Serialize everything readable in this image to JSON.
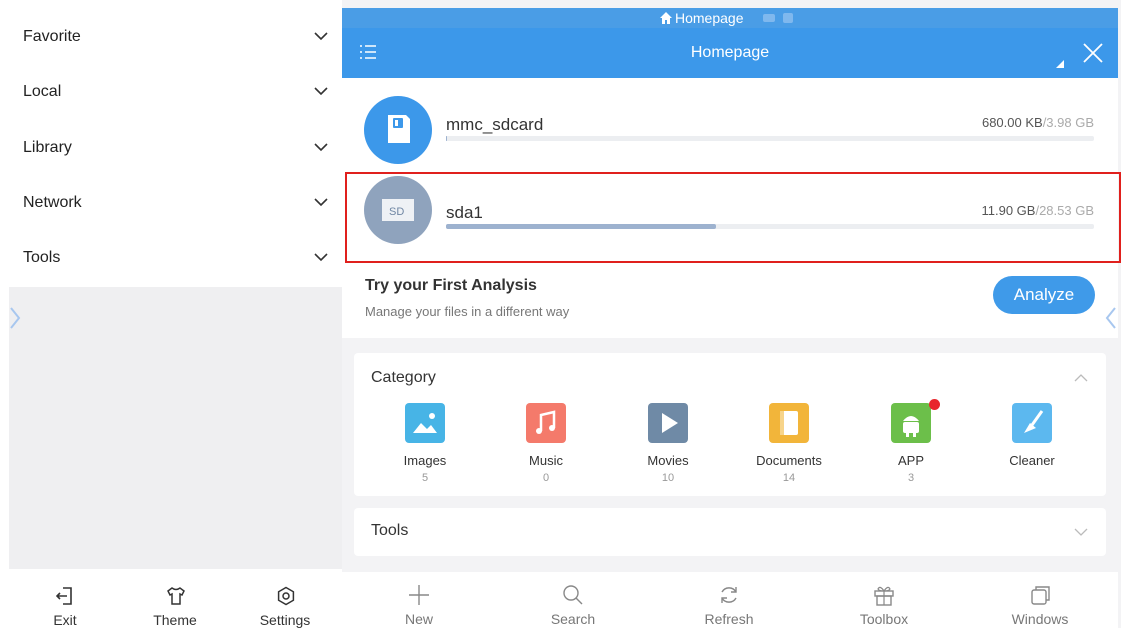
{
  "drawer": {
    "items": [
      {
        "label": "Favorite"
      },
      {
        "label": "Local"
      },
      {
        "label": "Library"
      },
      {
        "label": "Network"
      },
      {
        "label": "Tools"
      }
    ],
    "footer": [
      {
        "label": "Exit",
        "icon": "exit-icon"
      },
      {
        "label": "Theme",
        "icon": "shirt-icon"
      },
      {
        "label": "Settings",
        "icon": "gear-icon"
      }
    ]
  },
  "status_bar": {
    "title": "Homepage",
    "icon": "home-icon"
  },
  "app_bar": {
    "title": "Homepage",
    "menu_icon": "list-menu-icon",
    "close_icon": "close-icon"
  },
  "drives": [
    {
      "name": "mmc_sdcard",
      "used": "680.00 KB",
      "total": "/3.98 GB",
      "usage_fraction": 0.0002,
      "icon": "sdcard-icon",
      "color": "#3c98ea"
    },
    {
      "name": "sda1",
      "used": "11.90 GB",
      "total": "/28.53 GB",
      "usage_fraction": 0.417,
      "icon": "sd-chip-icon",
      "color": "#8fa3bd"
    }
  ],
  "analysis": {
    "title": "Try your First Analysis",
    "subtitle": "Manage your files in a different way",
    "button": "Analyze"
  },
  "category": {
    "title": "Category",
    "items": [
      {
        "label": "Images",
        "count": "5",
        "color": "#47b4e6",
        "icon": "image-icon"
      },
      {
        "label": "Music",
        "count": "0",
        "color": "#f47a6b",
        "icon": "music-icon"
      },
      {
        "label": "Movies",
        "count": "10",
        "color": "#6f8aa6",
        "icon": "play-icon"
      },
      {
        "label": "Documents",
        "count": "14",
        "color": "#f2b53a",
        "icon": "document-icon"
      },
      {
        "label": "APP",
        "count": "3",
        "color": "#6cbf4a",
        "icon": "android-icon"
      },
      {
        "label": "Cleaner",
        "count": "",
        "color": "#5cb8ef",
        "icon": "broom-icon"
      }
    ]
  },
  "tools": {
    "title": "Tools"
  },
  "toolbar": [
    {
      "label": "New",
      "icon": "plus-icon"
    },
    {
      "label": "Search",
      "icon": "search-icon"
    },
    {
      "label": "Refresh",
      "icon": "refresh-icon"
    },
    {
      "label": "Toolbox",
      "icon": "gift-icon"
    },
    {
      "label": "Windows",
      "icon": "windows-icon"
    }
  ],
  "colors": {
    "accent": "#3c98ea",
    "highlight": "#e0201d"
  }
}
